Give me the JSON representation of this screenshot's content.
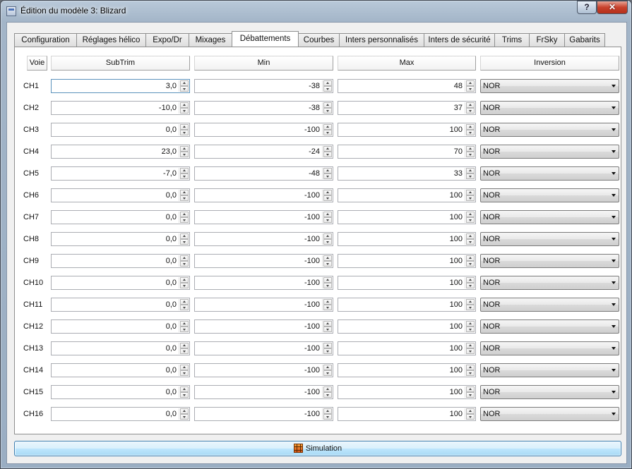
{
  "window": {
    "title": "Édition du modèle 3: Blizard",
    "help_label": "?",
    "close_label": "✕"
  },
  "tabs": [
    {
      "label": "Configuration"
    },
    {
      "label": "Réglages hélico"
    },
    {
      "label": "Expo/Dr"
    },
    {
      "label": "Mixages"
    },
    {
      "label": "Débattements",
      "active": true
    },
    {
      "label": "Courbes"
    },
    {
      "label": "Inters personnalisés"
    },
    {
      "label": "Inters de sécurité"
    },
    {
      "label": "Trims"
    },
    {
      "label": "FrSky"
    },
    {
      "label": "Gabarits"
    }
  ],
  "headers": {
    "voie": "Voie",
    "subtrim": "SubTrim",
    "min": "Min",
    "max": "Max",
    "inversion": "Inversion"
  },
  "rows": [
    {
      "ch": "CH1",
      "subtrim": "3,0",
      "min": "-38",
      "max": "48",
      "inv": "NOR"
    },
    {
      "ch": "CH2",
      "subtrim": "-10,0",
      "min": "-38",
      "max": "37",
      "inv": "NOR"
    },
    {
      "ch": "CH3",
      "subtrim": "0,0",
      "min": "-100",
      "max": "100",
      "inv": "NOR"
    },
    {
      "ch": "CH4",
      "subtrim": "23,0",
      "min": "-24",
      "max": "70",
      "inv": "NOR"
    },
    {
      "ch": "CH5",
      "subtrim": "-7,0",
      "min": "-48",
      "max": "33",
      "inv": "NOR"
    },
    {
      "ch": "CH6",
      "subtrim": "0,0",
      "min": "-100",
      "max": "100",
      "inv": "NOR"
    },
    {
      "ch": "CH7",
      "subtrim": "0,0",
      "min": "-100",
      "max": "100",
      "inv": "NOR"
    },
    {
      "ch": "CH8",
      "subtrim": "0,0",
      "min": "-100",
      "max": "100",
      "inv": "NOR"
    },
    {
      "ch": "CH9",
      "subtrim": "0,0",
      "min": "-100",
      "max": "100",
      "inv": "NOR"
    },
    {
      "ch": "CH10",
      "subtrim": "0,0",
      "min": "-100",
      "max": "100",
      "inv": "NOR"
    },
    {
      "ch": "CH11",
      "subtrim": "0,0",
      "min": "-100",
      "max": "100",
      "inv": "NOR"
    },
    {
      "ch": "CH12",
      "subtrim": "0,0",
      "min": "-100",
      "max": "100",
      "inv": "NOR"
    },
    {
      "ch": "CH13",
      "subtrim": "0,0",
      "min": "-100",
      "max": "100",
      "inv": "NOR"
    },
    {
      "ch": "CH14",
      "subtrim": "0,0",
      "min": "-100",
      "max": "100",
      "inv": "NOR"
    },
    {
      "ch": "CH15",
      "subtrim": "0,0",
      "min": "-100",
      "max": "100",
      "inv": "NOR"
    },
    {
      "ch": "CH16",
      "subtrim": "0,0",
      "min": "-100",
      "max": "100",
      "inv": "NOR"
    }
  ],
  "footer": {
    "simulation_label": "Simulation"
  }
}
